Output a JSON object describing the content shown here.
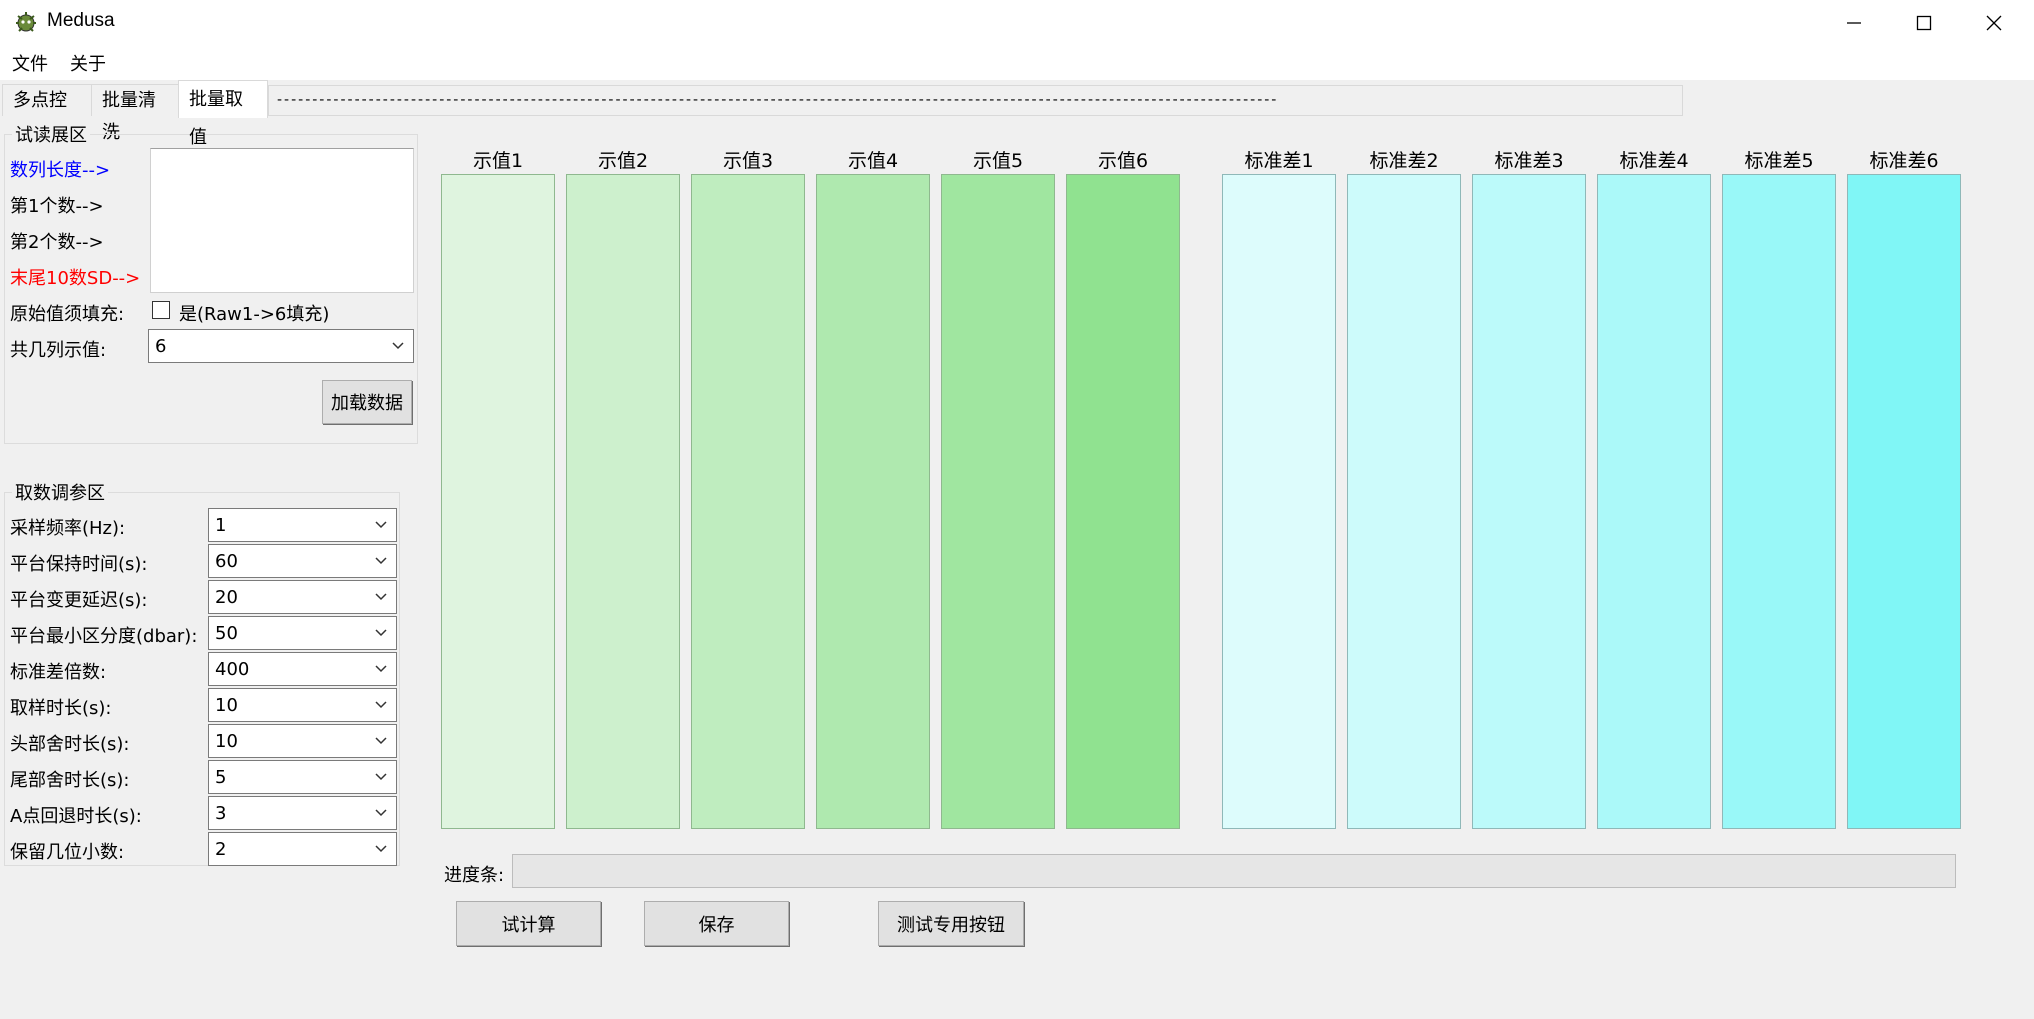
{
  "window": {
    "title": "Medusa"
  },
  "menu": [
    "文件",
    "关于"
  ],
  "tabs": [
    "多点控制",
    "批量清洗",
    "批量取值"
  ],
  "tab_strip_fill": "----------------------------------------------------------------------------------------------------------------------------------------------",
  "preview_group": {
    "title": "试读展区",
    "labels": [
      {
        "text": "数列长度-->",
        "color": "#0000ff"
      },
      {
        "text": "第1个数-->",
        "color": "#000000"
      },
      {
        "text": "第2个数-->",
        "color": "#000000"
      },
      {
        "text": "末尾10数SD-->",
        "color": "#ff0000"
      }
    ],
    "raw_fill_label": "原始值须填充:",
    "raw_fill_checkbox_label": "是(Raw1->6填充)",
    "raw_fill_checked": false,
    "cols_label": "共几列示值:",
    "cols_value": "6",
    "load_button": "加载数据"
  },
  "params_group": {
    "title": "取数调参区",
    "rows": [
      {
        "label": "采样频率(Hz):",
        "value": "1"
      },
      {
        "label": "平台保持时间(s):",
        "value": "60"
      },
      {
        "label": "平台变更延迟(s):",
        "value": "20"
      },
      {
        "label": "平台最小区分度(dbar):",
        "value": "50"
      },
      {
        "label": "标准差倍数:",
        "value": "400"
      },
      {
        "label": "取样时长(s):",
        "value": "10"
      },
      {
        "label": "头部舍时长(s):",
        "value": "10"
      },
      {
        "label": "尾部舍时长(s):",
        "value": "5"
      },
      {
        "label": "A点回退时长(s):",
        "value": "3"
      },
      {
        "label": "保留几位小数:",
        "value": "2"
      }
    ]
  },
  "value_columns": [
    {
      "label": "示值1",
      "color": "#dff4df"
    },
    {
      "label": "示值2",
      "color": "#cdf0cd"
    },
    {
      "label": "示值3",
      "color": "#bfedbf"
    },
    {
      "label": "示值4",
      "color": "#afe9af"
    },
    {
      "label": "示值5",
      "color": "#a0e6a0"
    },
    {
      "label": "示值6",
      "color": "#90e290"
    }
  ],
  "sd_columns": [
    {
      "label": "标准差1",
      "color": "#ddfcfc"
    },
    {
      "label": "标准差2",
      "color": "#cdfbfb"
    },
    {
      "label": "标准差3",
      "color": "#bcfafa"
    },
    {
      "label": "标准差4",
      "color": "#abf9f9"
    },
    {
      "label": "标准差5",
      "color": "#99f8f8"
    },
    {
      "label": "标准差6",
      "color": "#80f6f6"
    }
  ],
  "progress": {
    "label": "进度条:",
    "value": 0
  },
  "buttons": {
    "calc": "试计算",
    "save": "保存",
    "test": "测试专用按钮"
  },
  "icons": {
    "app": "medusa-logo-icon",
    "minimize": "minimize-icon",
    "maximize": "maximize-icon",
    "close": "close-icon",
    "dropdown": "chevron-down-icon"
  }
}
